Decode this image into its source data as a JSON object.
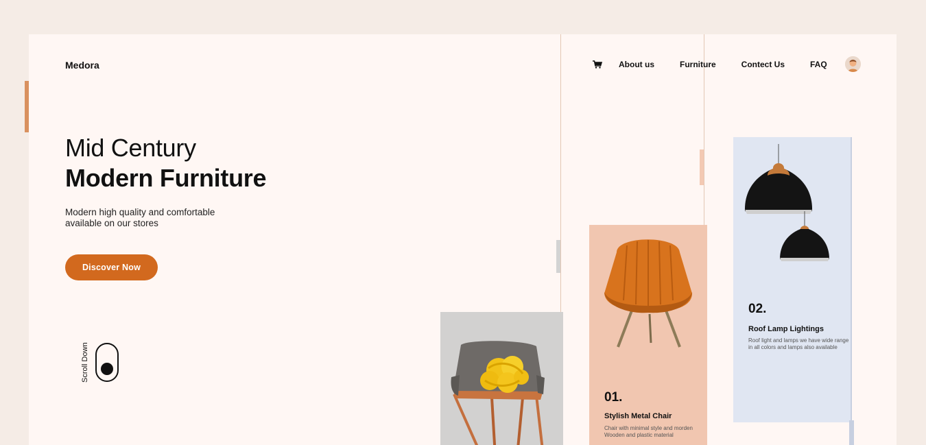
{
  "brand": "Medora",
  "nav": {
    "links": [
      "About us",
      "Furniture",
      "Contect Us",
      "FAQ"
    ],
    "cart_icon": "cart-icon",
    "avatar_icon": "user-avatar"
  },
  "hero": {
    "title_light": "Mid Century",
    "title_bold": "Modern Furniture",
    "subtitle": "Modern high quality and comfortable available on our stores",
    "cta_label": "Discover Now"
  },
  "scroll": {
    "label": "Scroll Down"
  },
  "cards": [
    {
      "number": "01.",
      "title": "Stylish Metal Chair",
      "description": "Chair with minimal style and morden Wooden and plastic material",
      "image_icon": "orange-chair-image",
      "bg": "#f1c6b0"
    },
    {
      "number": "02.",
      "title": "Roof Lamp Lightings",
      "description": "Roof light and lamps we have wide range in all colors and lamps also available",
      "image_icon": "pendant-lamps-image",
      "bg": "#e0e6f2"
    }
  ],
  "colors": {
    "accent": "#d2691e",
    "page_bg": "#fff7f4",
    "outer_bg": "#f5ece6"
  }
}
